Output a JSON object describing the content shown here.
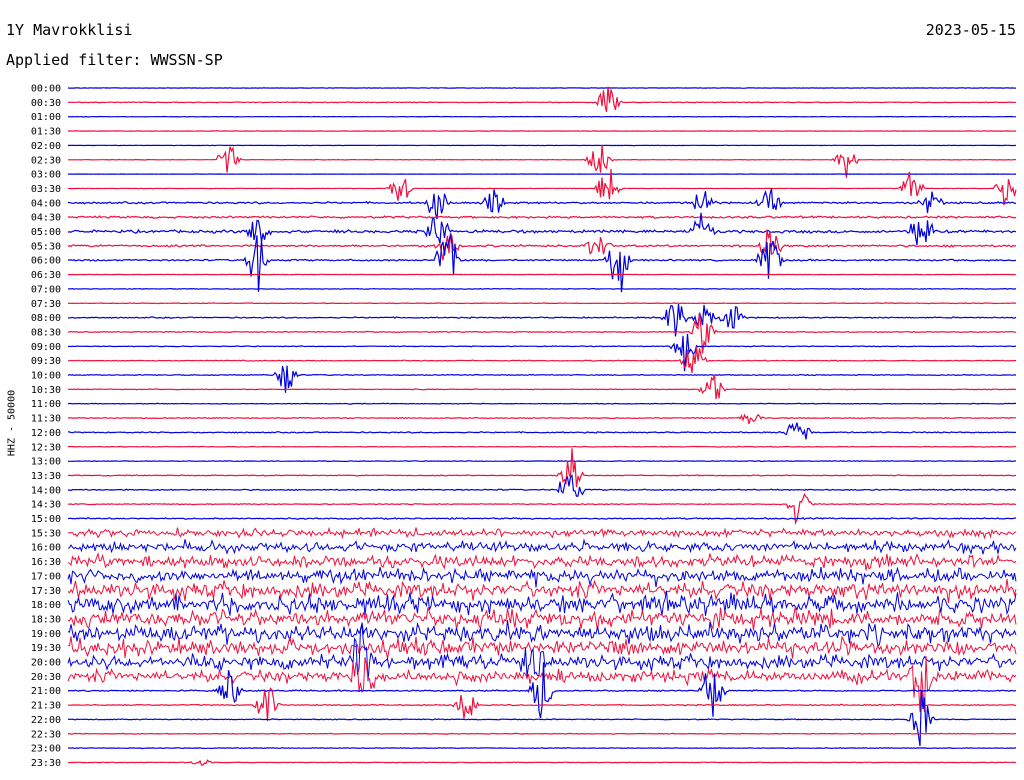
{
  "header": {
    "station": "1Y Mavrokklisi",
    "date": "2023-05-15",
    "filter": "Applied filter: WWSSN-SP"
  },
  "chart_data": {
    "type": "line",
    "title": "1Y Mavrokklisi",
    "subtitle": "Applied filter: WWSSN-SP",
    "ylabel": "HHZ - 50000",
    "rows": [
      "00:00",
      "00:30",
      "01:00",
      "01:30",
      "02:00",
      "02:30",
      "03:00",
      "03:30",
      "04:00",
      "04:30",
      "05:00",
      "05:30",
      "06:00",
      "06:30",
      "07:00",
      "07:30",
      "08:00",
      "08:30",
      "09:00",
      "09:30",
      "10:00",
      "10:30",
      "11:00",
      "11:30",
      "12:00",
      "12:30",
      "13:00",
      "13:30",
      "14:00",
      "14:30",
      "15:00",
      "15:30",
      "16:00",
      "16:30",
      "17:00",
      "17:30",
      "18:00",
      "18:30",
      "19:00",
      "19:30",
      "20:00",
      "20:30",
      "21:00",
      "21:30",
      "22:00",
      "22:30",
      "23:00",
      "23:30"
    ],
    "colors": [
      "#0000e0",
      "#f0103c"
    ],
    "activity": [
      0.2,
      0.35,
      0.2,
      0.15,
      0.15,
      0.2,
      0.1,
      0.2,
      0.8,
      0.9,
      1.2,
      0.9,
      0.7,
      0.2,
      0.3,
      0.3,
      0.5,
      0.4,
      0.3,
      0.4,
      0.4,
      0.3,
      0.3,
      0.4,
      0.5,
      0.3,
      0.3,
      0.4,
      0.5,
      0.4,
      0.6,
      2.0,
      2.5,
      3.0,
      3.5,
      4.0,
      4.5,
      4.5,
      4.5,
      4.0,
      3.5,
      3.0,
      0.6,
      0.5,
      0.4,
      0.3,
      0.3,
      0.3
    ],
    "events": [
      {
        "row": 1,
        "pos": 0.57,
        "amp": 30
      },
      {
        "row": 5,
        "pos": 0.17,
        "amp": 25
      },
      {
        "row": 5,
        "pos": 0.56,
        "amp": 25
      },
      {
        "row": 5,
        "pos": 0.82,
        "amp": 20
      },
      {
        "row": 7,
        "pos": 0.35,
        "amp": 20
      },
      {
        "row": 7,
        "pos": 0.57,
        "amp": 30
      },
      {
        "row": 7,
        "pos": 0.89,
        "amp": 25
      },
      {
        "row": 7,
        "pos": 0.99,
        "amp": 25
      },
      {
        "row": 8,
        "pos": 0.39,
        "amp": 25
      },
      {
        "row": 8,
        "pos": 0.45,
        "amp": 20
      },
      {
        "row": 8,
        "pos": 0.67,
        "amp": 18
      },
      {
        "row": 8,
        "pos": 0.74,
        "amp": 20
      },
      {
        "row": 8,
        "pos": 0.91,
        "amp": 18
      },
      {
        "row": 10,
        "pos": 0.2,
        "amp": 25
      },
      {
        "row": 10,
        "pos": 0.39,
        "amp": 25
      },
      {
        "row": 10,
        "pos": 0.67,
        "amp": 25
      },
      {
        "row": 10,
        "pos": 0.9,
        "amp": 30
      },
      {
        "row": 11,
        "pos": 0.4,
        "amp": 25
      },
      {
        "row": 11,
        "pos": 0.56,
        "amp": 25
      },
      {
        "row": 11,
        "pos": 0.74,
        "amp": 25
      },
      {
        "row": 12,
        "pos": 0.2,
        "amp": 40
      },
      {
        "row": 12,
        "pos": 0.4,
        "amp": 50
      },
      {
        "row": 12,
        "pos": 0.58,
        "amp": 50
      },
      {
        "row": 12,
        "pos": 0.74,
        "amp": 40
      },
      {
        "row": 16,
        "pos": 0.64,
        "amp": 30
      },
      {
        "row": 16,
        "pos": 0.67,
        "amp": 30
      },
      {
        "row": 16,
        "pos": 0.7,
        "amp": 30
      },
      {
        "row": 17,
        "pos": 0.67,
        "amp": 30
      },
      {
        "row": 18,
        "pos": 0.65,
        "amp": 35
      },
      {
        "row": 19,
        "pos": 0.66,
        "amp": 30
      },
      {
        "row": 20,
        "pos": 0.23,
        "amp": 25
      },
      {
        "row": 21,
        "pos": 0.68,
        "amp": 25
      },
      {
        "row": 23,
        "pos": 0.72,
        "amp": 10
      },
      {
        "row": 24,
        "pos": 0.77,
        "amp": 25
      },
      {
        "row": 27,
        "pos": 0.53,
        "amp": 40
      },
      {
        "row": 28,
        "pos": 0.53,
        "amp": 30
      },
      {
        "row": 29,
        "pos": 0.77,
        "amp": 25
      },
      {
        "row": 40,
        "pos": 0.31,
        "amp": 40
      },
      {
        "row": 40,
        "pos": 0.49,
        "amp": 40
      },
      {
        "row": 41,
        "pos": 0.31,
        "amp": 40
      },
      {
        "row": 41,
        "pos": 0.9,
        "amp": 50
      },
      {
        "row": 42,
        "pos": 0.17,
        "amp": 25
      },
      {
        "row": 42,
        "pos": 0.5,
        "amp": 35
      },
      {
        "row": 42,
        "pos": 0.68,
        "amp": 35
      },
      {
        "row": 43,
        "pos": 0.21,
        "amp": 25
      },
      {
        "row": 43,
        "pos": 0.42,
        "amp": 30
      },
      {
        "row": 44,
        "pos": 0.9,
        "amp": 40
      },
      {
        "row": 47,
        "pos": 0.14,
        "amp": 5
      }
    ]
  }
}
